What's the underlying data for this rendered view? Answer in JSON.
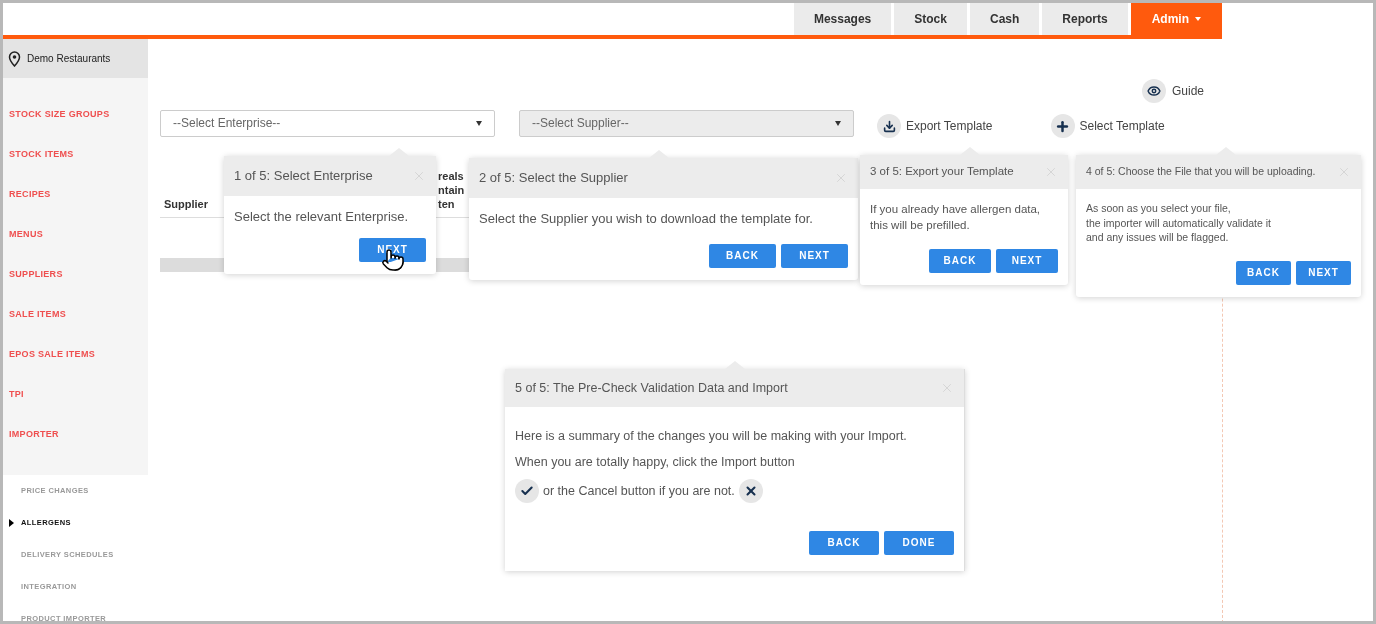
{
  "nav": {
    "tabs": [
      {
        "label": "Messages",
        "selected": false
      },
      {
        "label": "Stock",
        "selected": false
      },
      {
        "label": "Cash",
        "selected": false
      },
      {
        "label": "Reports",
        "selected": false
      },
      {
        "label": "Admin",
        "selected": true
      }
    ]
  },
  "sidebar": {
    "location": "Demo Restaurants",
    "items": [
      {
        "label": "STOCK SIZE GROUPS"
      },
      {
        "label": "STOCK ITEMS"
      },
      {
        "label": "RECIPES"
      },
      {
        "label": "MENUS"
      },
      {
        "label": "SUPPLIERS"
      },
      {
        "label": "SALE ITEMS"
      },
      {
        "label": "EPOS SALE ITEMS"
      },
      {
        "label": "TPI"
      },
      {
        "label": "IMPORTER",
        "children": [
          {
            "label": "PRICE CHANGES",
            "selected": false
          },
          {
            "label": "ALLERGENS",
            "selected": true
          },
          {
            "label": "DELIVERY SCHEDULES",
            "selected": false
          },
          {
            "label": "INTEGRATION",
            "selected": false
          },
          {
            "label": "PRODUCT IMPORTER",
            "selected": false
          }
        ]
      }
    ]
  },
  "guide": {
    "label": "Guide"
  },
  "filters": [
    {
      "placeholder": "--Select Enterprise--",
      "disabled": false
    },
    {
      "placeholder": "--Select Supplier--",
      "disabled": true
    }
  ],
  "actions": [
    {
      "label": "Export Template",
      "kind": "download"
    },
    {
      "label": "Select Template",
      "kind": "add"
    }
  ],
  "table": {
    "columns": [
      {
        "lines": [
          "Supplier"
        ]
      },
      {
        "lines": [
          "reals",
          "ntain",
          "ten"
        ]
      }
    ]
  },
  "tour_steps": [
    {
      "title": "1 of 5: Select Enterprise",
      "body": [
        {
          "text": "Select the relevant Enterprise.",
          "kind": "plain"
        }
      ],
      "buttons": [
        "NEXT"
      ]
    },
    {
      "title": "2 of 5: Select the Supplier",
      "body": [
        {
          "text": "Select the Supplier you wish to download the template for.",
          "kind": "plain"
        }
      ],
      "buttons": [
        "BACK",
        "NEXT"
      ]
    },
    {
      "title": "3 of 5: Export your Template",
      "body": [
        {
          "text": "If you already have allergen data,",
          "kind": "plain"
        },
        {
          "text": "this will be prefilled.",
          "kind": "plain"
        }
      ],
      "buttons": [
        "BACK",
        "NEXT"
      ]
    },
    {
      "title": "4 of 5: Choose the File that you will be uploading.",
      "body": [
        {
          "text": "As soon as you select your file,",
          "kind": "plain"
        },
        {
          "text": "the importer will automatically validate it",
          "kind": "plain"
        },
        {
          "text": "and any issues will be flagged.",
          "kind": "plain"
        }
      ],
      "buttons": [
        "BACK",
        "NEXT"
      ]
    },
    {
      "title": "5 of 5: The Pre-Check Validation Data and Import",
      "body": [
        {
          "text": "Here is a summary of the changes you will be making with your Import.",
          "kind": "plain"
        },
        {
          "text": "When you are totally happy, click the Import button",
          "kind": "plain"
        },
        {
          "text": "or the Cancel button if you are not.",
          "kind": "with-icons"
        }
      ],
      "buttons": [
        "BACK",
        "DONE"
      ]
    }
  ]
}
